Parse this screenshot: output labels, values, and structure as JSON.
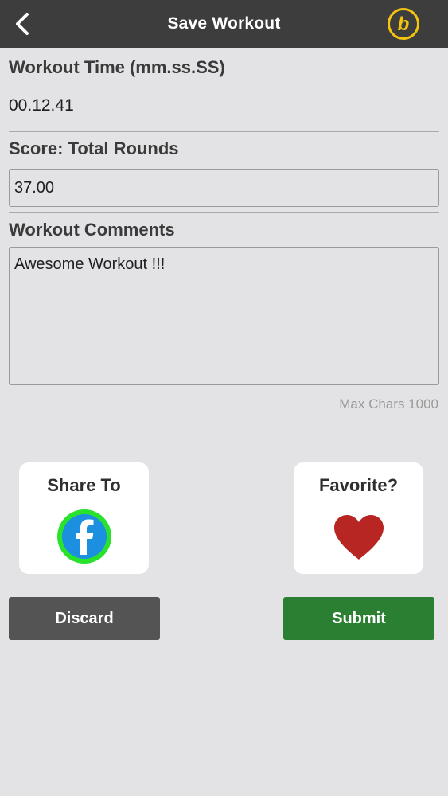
{
  "header": {
    "title": "Save Workout",
    "back_icon": "chevron-left-icon",
    "brand_icon": "b-logo-icon",
    "brand_color": "#f2c40f"
  },
  "workout_time": {
    "label": "Workout Time (mm.ss.SS)",
    "value": "00.12.41"
  },
  "score": {
    "label": "Score: Total Rounds",
    "value": "37.00"
  },
  "comments": {
    "label": "Workout Comments",
    "value": "Awesome Workout !!!",
    "max_chars_label": "Max Chars 1000"
  },
  "share": {
    "label": "Share To",
    "icon": "facebook-icon",
    "ring_color": "#28e22d",
    "icon_color": "#1d8fe0"
  },
  "favorite": {
    "label": "Favorite?",
    "icon": "heart-icon",
    "icon_color": "#b82624"
  },
  "actions": {
    "discard_label": "Discard",
    "submit_label": "Submit",
    "discard_color": "#545454",
    "submit_color": "#2a7f32"
  }
}
